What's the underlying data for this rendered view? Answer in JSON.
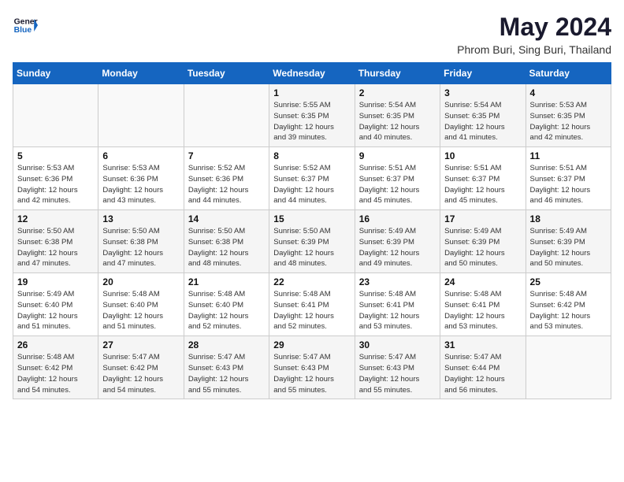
{
  "header": {
    "logo_line1": "General",
    "logo_line2": "Blue",
    "title": "May 2024",
    "subtitle": "Phrom Buri, Sing Buri, Thailand"
  },
  "weekdays": [
    "Sunday",
    "Monday",
    "Tuesday",
    "Wednesday",
    "Thursday",
    "Friday",
    "Saturday"
  ],
  "weeks": [
    [
      {
        "day": "",
        "info": ""
      },
      {
        "day": "",
        "info": ""
      },
      {
        "day": "",
        "info": ""
      },
      {
        "day": "1",
        "info": "Sunrise: 5:55 AM\nSunset: 6:35 PM\nDaylight: 12 hours\nand 39 minutes."
      },
      {
        "day": "2",
        "info": "Sunrise: 5:54 AM\nSunset: 6:35 PM\nDaylight: 12 hours\nand 40 minutes."
      },
      {
        "day": "3",
        "info": "Sunrise: 5:54 AM\nSunset: 6:35 PM\nDaylight: 12 hours\nand 41 minutes."
      },
      {
        "day": "4",
        "info": "Sunrise: 5:53 AM\nSunset: 6:35 PM\nDaylight: 12 hours\nand 42 minutes."
      }
    ],
    [
      {
        "day": "5",
        "info": "Sunrise: 5:53 AM\nSunset: 6:36 PM\nDaylight: 12 hours\nand 42 minutes."
      },
      {
        "day": "6",
        "info": "Sunrise: 5:53 AM\nSunset: 6:36 PM\nDaylight: 12 hours\nand 43 minutes."
      },
      {
        "day": "7",
        "info": "Sunrise: 5:52 AM\nSunset: 6:36 PM\nDaylight: 12 hours\nand 44 minutes."
      },
      {
        "day": "8",
        "info": "Sunrise: 5:52 AM\nSunset: 6:37 PM\nDaylight: 12 hours\nand 44 minutes."
      },
      {
        "day": "9",
        "info": "Sunrise: 5:51 AM\nSunset: 6:37 PM\nDaylight: 12 hours\nand 45 minutes."
      },
      {
        "day": "10",
        "info": "Sunrise: 5:51 AM\nSunset: 6:37 PM\nDaylight: 12 hours\nand 45 minutes."
      },
      {
        "day": "11",
        "info": "Sunrise: 5:51 AM\nSunset: 6:37 PM\nDaylight: 12 hours\nand 46 minutes."
      }
    ],
    [
      {
        "day": "12",
        "info": "Sunrise: 5:50 AM\nSunset: 6:38 PM\nDaylight: 12 hours\nand 47 minutes."
      },
      {
        "day": "13",
        "info": "Sunrise: 5:50 AM\nSunset: 6:38 PM\nDaylight: 12 hours\nand 47 minutes."
      },
      {
        "day": "14",
        "info": "Sunrise: 5:50 AM\nSunset: 6:38 PM\nDaylight: 12 hours\nand 48 minutes."
      },
      {
        "day": "15",
        "info": "Sunrise: 5:50 AM\nSunset: 6:39 PM\nDaylight: 12 hours\nand 48 minutes."
      },
      {
        "day": "16",
        "info": "Sunrise: 5:49 AM\nSunset: 6:39 PM\nDaylight: 12 hours\nand 49 minutes."
      },
      {
        "day": "17",
        "info": "Sunrise: 5:49 AM\nSunset: 6:39 PM\nDaylight: 12 hours\nand 50 minutes."
      },
      {
        "day": "18",
        "info": "Sunrise: 5:49 AM\nSunset: 6:39 PM\nDaylight: 12 hours\nand 50 minutes."
      }
    ],
    [
      {
        "day": "19",
        "info": "Sunrise: 5:49 AM\nSunset: 6:40 PM\nDaylight: 12 hours\nand 51 minutes."
      },
      {
        "day": "20",
        "info": "Sunrise: 5:48 AM\nSunset: 6:40 PM\nDaylight: 12 hours\nand 51 minutes."
      },
      {
        "day": "21",
        "info": "Sunrise: 5:48 AM\nSunset: 6:40 PM\nDaylight: 12 hours\nand 52 minutes."
      },
      {
        "day": "22",
        "info": "Sunrise: 5:48 AM\nSunset: 6:41 PM\nDaylight: 12 hours\nand 52 minutes."
      },
      {
        "day": "23",
        "info": "Sunrise: 5:48 AM\nSunset: 6:41 PM\nDaylight: 12 hours\nand 53 minutes."
      },
      {
        "day": "24",
        "info": "Sunrise: 5:48 AM\nSunset: 6:41 PM\nDaylight: 12 hours\nand 53 minutes."
      },
      {
        "day": "25",
        "info": "Sunrise: 5:48 AM\nSunset: 6:42 PM\nDaylight: 12 hours\nand 53 minutes."
      }
    ],
    [
      {
        "day": "26",
        "info": "Sunrise: 5:48 AM\nSunset: 6:42 PM\nDaylight: 12 hours\nand 54 minutes."
      },
      {
        "day": "27",
        "info": "Sunrise: 5:47 AM\nSunset: 6:42 PM\nDaylight: 12 hours\nand 54 minutes."
      },
      {
        "day": "28",
        "info": "Sunrise: 5:47 AM\nSunset: 6:43 PM\nDaylight: 12 hours\nand 55 minutes."
      },
      {
        "day": "29",
        "info": "Sunrise: 5:47 AM\nSunset: 6:43 PM\nDaylight: 12 hours\nand 55 minutes."
      },
      {
        "day": "30",
        "info": "Sunrise: 5:47 AM\nSunset: 6:43 PM\nDaylight: 12 hours\nand 55 minutes."
      },
      {
        "day": "31",
        "info": "Sunrise: 5:47 AM\nSunset: 6:44 PM\nDaylight: 12 hours\nand 56 minutes."
      },
      {
        "day": "",
        "info": ""
      }
    ]
  ]
}
